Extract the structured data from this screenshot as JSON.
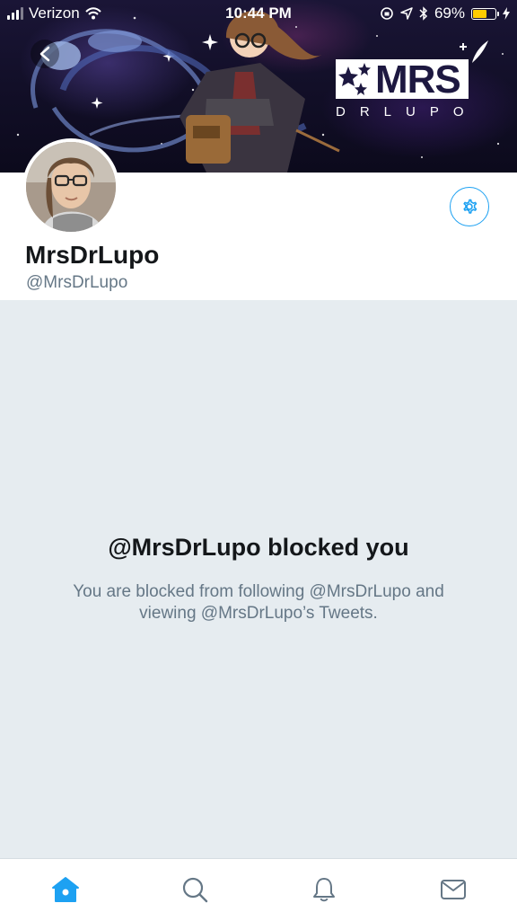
{
  "status_bar": {
    "carrier": "Verizon",
    "time": "10:44 PM",
    "battery": "69%",
    "battery_level": 0.69
  },
  "banner": {
    "logo_title": "MRS",
    "logo_subtitle": "DRLUPO"
  },
  "profile": {
    "display_name": "MrsDrLupo",
    "handle": "@MrsDrLupo"
  },
  "blocked": {
    "title": "@MrsDrLupo blocked you",
    "description": "You are blocked from following @MrsDrLupo and viewing @MrsDrLupo’s Tweets."
  },
  "tabbar": {
    "items": [
      "home-icon",
      "search-icon",
      "bell-icon",
      "mail-icon"
    ],
    "active": "home"
  },
  "colors": {
    "accent": "#1da1f2",
    "background": "#e6ecf0",
    "battery": "#ffcc00"
  }
}
